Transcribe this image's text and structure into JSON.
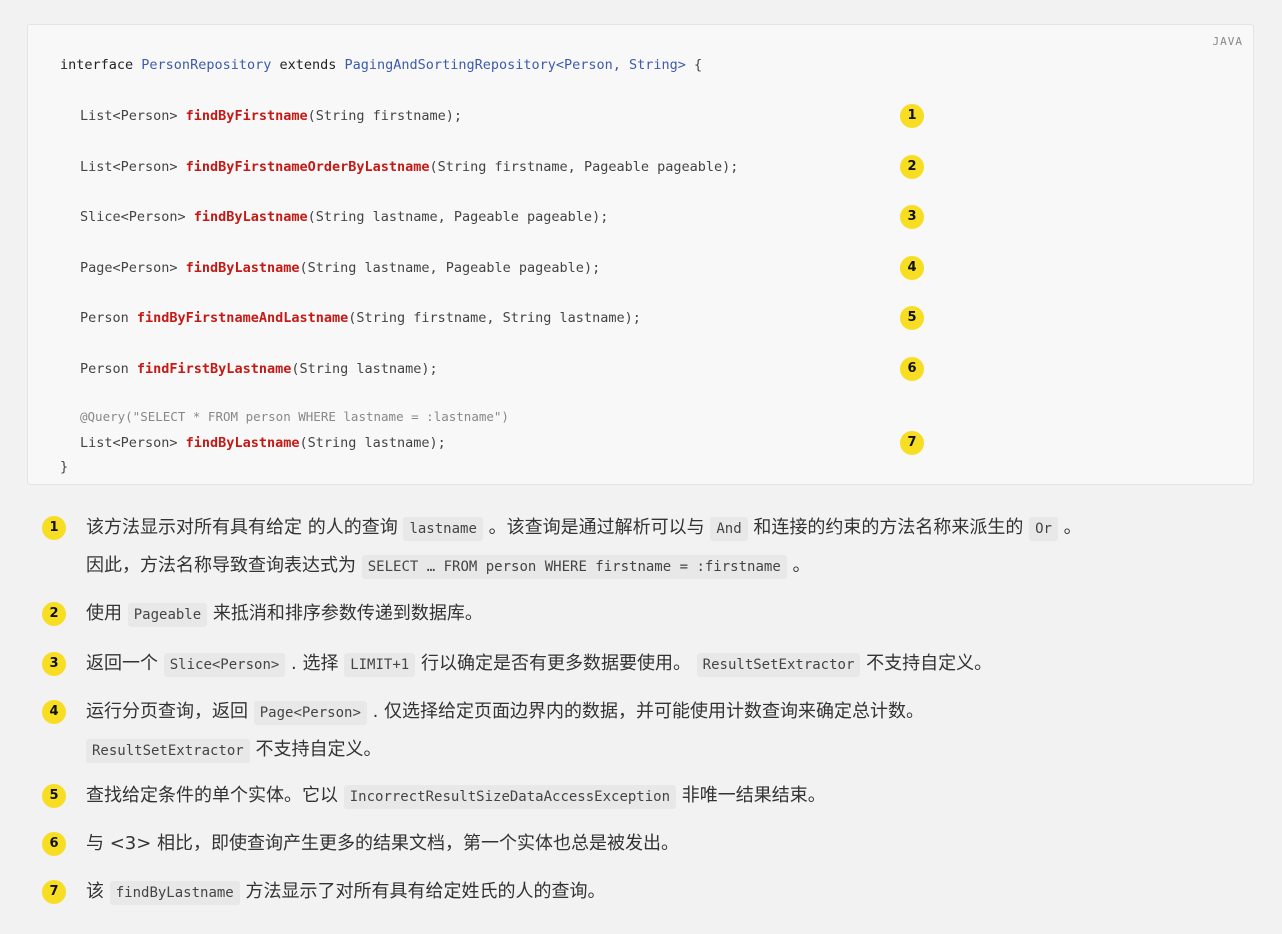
{
  "code_block": {
    "language": "JAVA",
    "header": {
      "kw_interface": "interface",
      "name": "PersonRepository",
      "kw_extends": "extends",
      "parent": "PagingAndSortingRepository<Person, String>",
      "brace": " {"
    },
    "lines": [
      {
        "ret": "List<Person> ",
        "method": "findByFirstname",
        "params": "(String firstname);",
        "callout": "1"
      },
      {
        "ret": "List<Person> ",
        "method": "findByFirstnameOrderByLastname",
        "params": "(String firstname, Pageable pageable);",
        "callout": "2"
      },
      {
        "ret": "Slice<Person> ",
        "method": "findByLastname",
        "params": "(String lastname, Pageable pageable);",
        "callout": "3"
      },
      {
        "ret": "Page<Person> ",
        "method": "findByLastname",
        "params": "(String lastname, Pageable pageable);",
        "callout": "4"
      },
      {
        "ret": "Person ",
        "method": "findByFirstnameAndLastname",
        "params": "(String firstname, String lastname);",
        "callout": "5"
      },
      {
        "ret": "Person ",
        "method": "findFirstByLastname",
        "params": "(String lastname);",
        "callout": "6"
      },
      {
        "ret": "List<Person> ",
        "method": "findByLastname",
        "params": "(String lastname);",
        "callout": "7"
      }
    ],
    "annotation": "@Query(\"SELECT * FROM person WHERE lastname = :lastname\")",
    "closing_brace": "}"
  },
  "notes": [
    {
      "num": "1",
      "parts": [
        {
          "t": "该方法显示对所有具有给定 的人的查询 "
        },
        {
          "c": "lastname"
        },
        {
          "t": " 。该查询是通过解析可以与 "
        },
        {
          "c": "And"
        },
        {
          "t": " 和连接的约束的方法名称来派生的 "
        },
        {
          "c": "Or"
        },
        {
          "t": " 。"
        }
      ],
      "parts2": [
        {
          "t": "因此，方法名称导致查询表达式为 "
        },
        {
          "c": "SELECT … FROM person WHERE firstname = :firstname"
        },
        {
          "t": " 。"
        }
      ]
    },
    {
      "num": "2",
      "parts": [
        {
          "t": "使用 "
        },
        {
          "c": "Pageable"
        },
        {
          "t": " 来抵消和排序参数传递到数据库。"
        }
      ]
    },
    {
      "num": "3",
      "parts": [
        {
          "t": "返回一个 "
        },
        {
          "c": "Slice<Person>"
        },
        {
          "t": " . 选择 "
        },
        {
          "c": "LIMIT+1"
        },
        {
          "t": " 行以确定是否有更多数据要使用。 "
        },
        {
          "c": "ResultSetExtractor"
        },
        {
          "t": " 不支持自定义。"
        }
      ]
    },
    {
      "num": "4",
      "parts": [
        {
          "t": "运行分页查询，返回 "
        },
        {
          "c": "Page<Person>"
        },
        {
          "t": " . 仅选择给定页面边界内的数据，并可能使用计数查询来确定总计数。"
        }
      ],
      "parts2": [
        {
          "c": "ResultSetExtractor"
        },
        {
          "t": " 不支持自定义。"
        }
      ]
    },
    {
      "num": "5",
      "parts": [
        {
          "t": "查找给定条件的单个实体。它以 "
        },
        {
          "c": "IncorrectResultSizeDataAccessException"
        },
        {
          "t": " 非唯一结果结束。"
        }
      ]
    },
    {
      "num": "6",
      "parts": [
        {
          "t": "与 <3> 相比，即使查询产生更多的结果文档，第一个实体也总是被发出。"
        }
      ]
    },
    {
      "num": "7",
      "parts": [
        {
          "t": "该 "
        },
        {
          "c": "findByLastname"
        },
        {
          "t": " 方法显示了对所有具有给定姓氏的人的查询。"
        }
      ]
    }
  ]
}
